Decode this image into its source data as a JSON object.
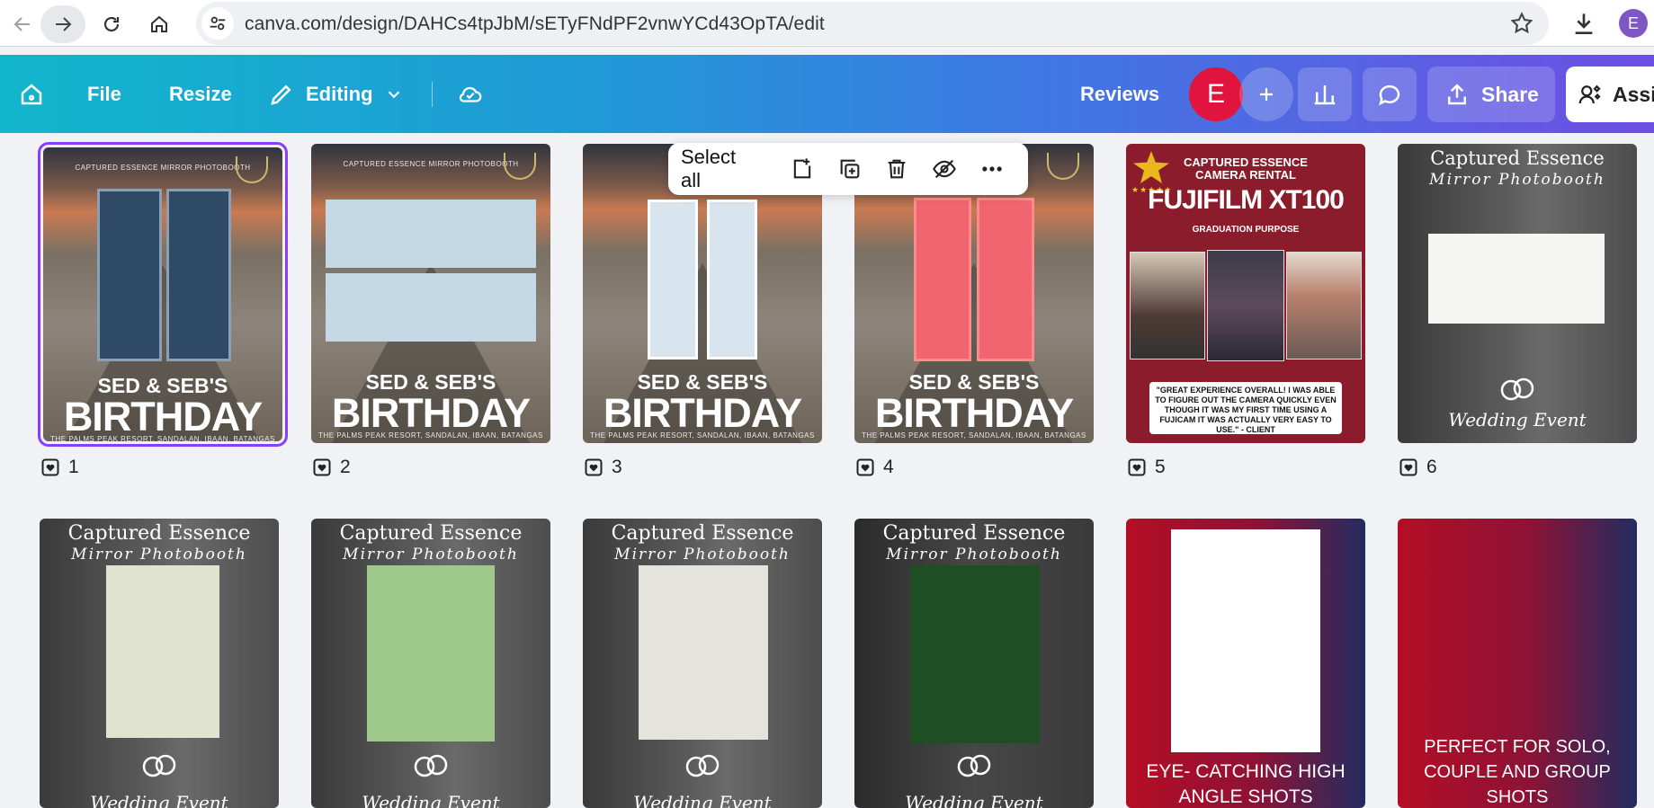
{
  "browser": {
    "url": "canva.com/design/DAHCs4tpJbM/sETyFNdPF2vnwYCd43OpTA/edit",
    "profile_initial": "E"
  },
  "toolbar": {
    "file": "File",
    "resize": "Resize",
    "editing": "Editing",
    "reviews": "Reviews",
    "avatar_initial": "E",
    "share": "Share",
    "assistant": "Assi"
  },
  "floating_menu": {
    "select_all": "Select all"
  },
  "birthday": {
    "header": "CAPTURED ESSENCE MIRROR PHOTOBOOTH",
    "title_top": "SED & SEB'S",
    "title_main": "BIRTHDAY",
    "venue": "THE PALMS PEAK RESORT, SANDALAN, IBAAN, BATANGAS"
  },
  "camera_rental": {
    "title_line1": "CAPTURED ESSENCE",
    "title_line2": "CAMERA RENTAL",
    "product": "FUJIFILM XT100",
    "purpose": "GRADUATION PURPOSE",
    "stars": "★★★★★",
    "quote": "\"GREAT EXPERIENCE OVERALL! I WAS ABLE TO FIGURE OUT THE CAMERA QUICKLY EVEN THOUGH IT WAS MY FIRST TIME USING A FUJICAM IT WAS ACTUALLY VERY EASY TO USE.\" - CLIENT"
  },
  "wedding": {
    "title": "Captured Essence",
    "subtitle": "Mirror Photobooth",
    "footer": "Wedding Event"
  },
  "promo": {
    "high_angle": "EYE- CATCHING HIGH ANGLE SHOTS",
    "solo": "PERFECT FOR SOLO, COUPLE AND GROUP SHOTS"
  },
  "pages": [
    "1",
    "2",
    "3",
    "4",
    "5",
    "6"
  ],
  "colors": {
    "selected_outline": "#8b3dff",
    "avatar": "#e0143c",
    "profile": "#7e57c2"
  }
}
